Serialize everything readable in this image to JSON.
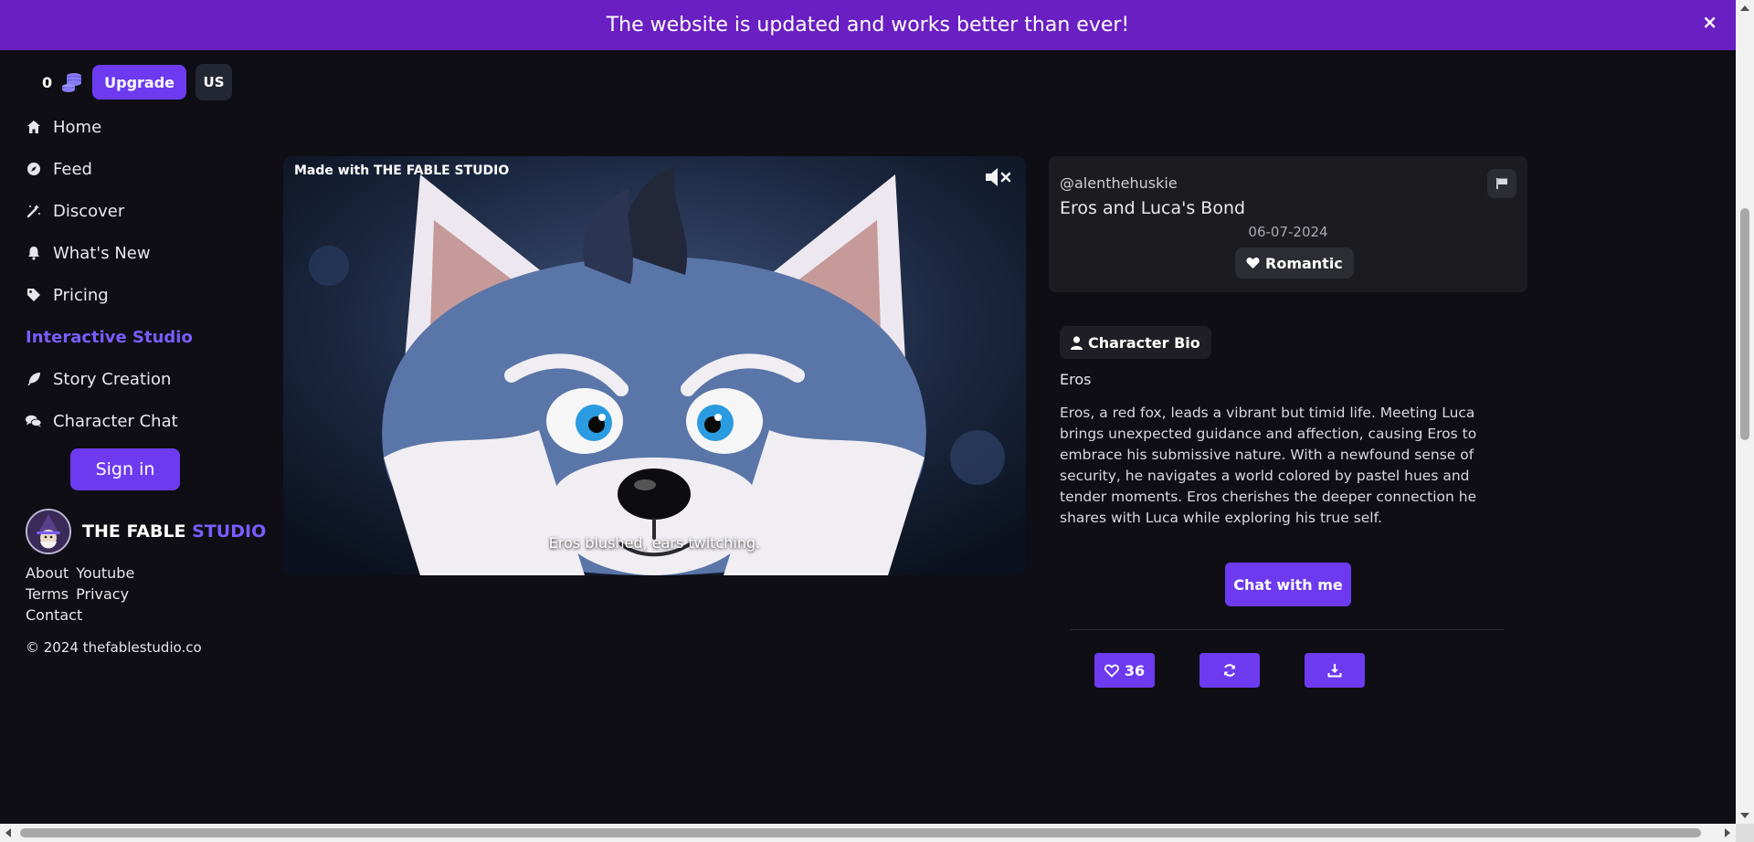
{
  "banner": {
    "message": "The website is updated and works better than ever!",
    "close_label": "×"
  },
  "account": {
    "coins": "0",
    "upgrade_label": "Upgrade",
    "locale": "US"
  },
  "nav": {
    "items": [
      {
        "label": "Home",
        "icon": "home-icon"
      },
      {
        "label": "Feed",
        "icon": "compass-icon"
      },
      {
        "label": "Discover",
        "icon": "magic-wand-icon"
      },
      {
        "label": "What's New",
        "icon": "bell-icon"
      },
      {
        "label": "Pricing",
        "icon": "tag-icon"
      },
      {
        "label": "Interactive Studio",
        "icon": ""
      },
      {
        "label": "Story Creation",
        "icon": "feather-icon"
      },
      {
        "label": "Character Chat",
        "icon": "chat-bubbles-icon"
      }
    ],
    "signin_label": "Sign in"
  },
  "brand": {
    "name_main": "THE FABLE",
    "name_accent": "STUDIO"
  },
  "footer": {
    "links_row1": [
      "About",
      "Youtube"
    ],
    "links_row2": [
      "Terms",
      "Privacy"
    ],
    "links_row3": [
      "Contact"
    ],
    "copyright": "© 2024 thefablestudio.co"
  },
  "media": {
    "watermark": "Made with THE FABLE STUDIO",
    "caption": "Eros blushed, ears twitching."
  },
  "story": {
    "handle": "@alenthehuskie",
    "title": "Eros and Luca's Bond",
    "date": "06-07-2024",
    "genre": "Romantic"
  },
  "bio": {
    "tab_label": "Character Bio",
    "character_name": "Eros",
    "text": "Eros, a red fox, leads a vibrant but timid life. Meeting Luca brings unexpected guidance and affection, causing Eros to embrace his submissive nature. With a newfound sense of security, he navigates a world colored by pastel hues and tender moments. Eros cherishes the deeper connection he shares with Luca while exploring his true self.",
    "chat_label": "Chat with me"
  },
  "actions": {
    "likes": "36"
  },
  "colors": {
    "accent": "#6d3af0",
    "banner": "#6a1fc2",
    "background": "#0e0e14",
    "active_nav": "#7a5cff"
  }
}
